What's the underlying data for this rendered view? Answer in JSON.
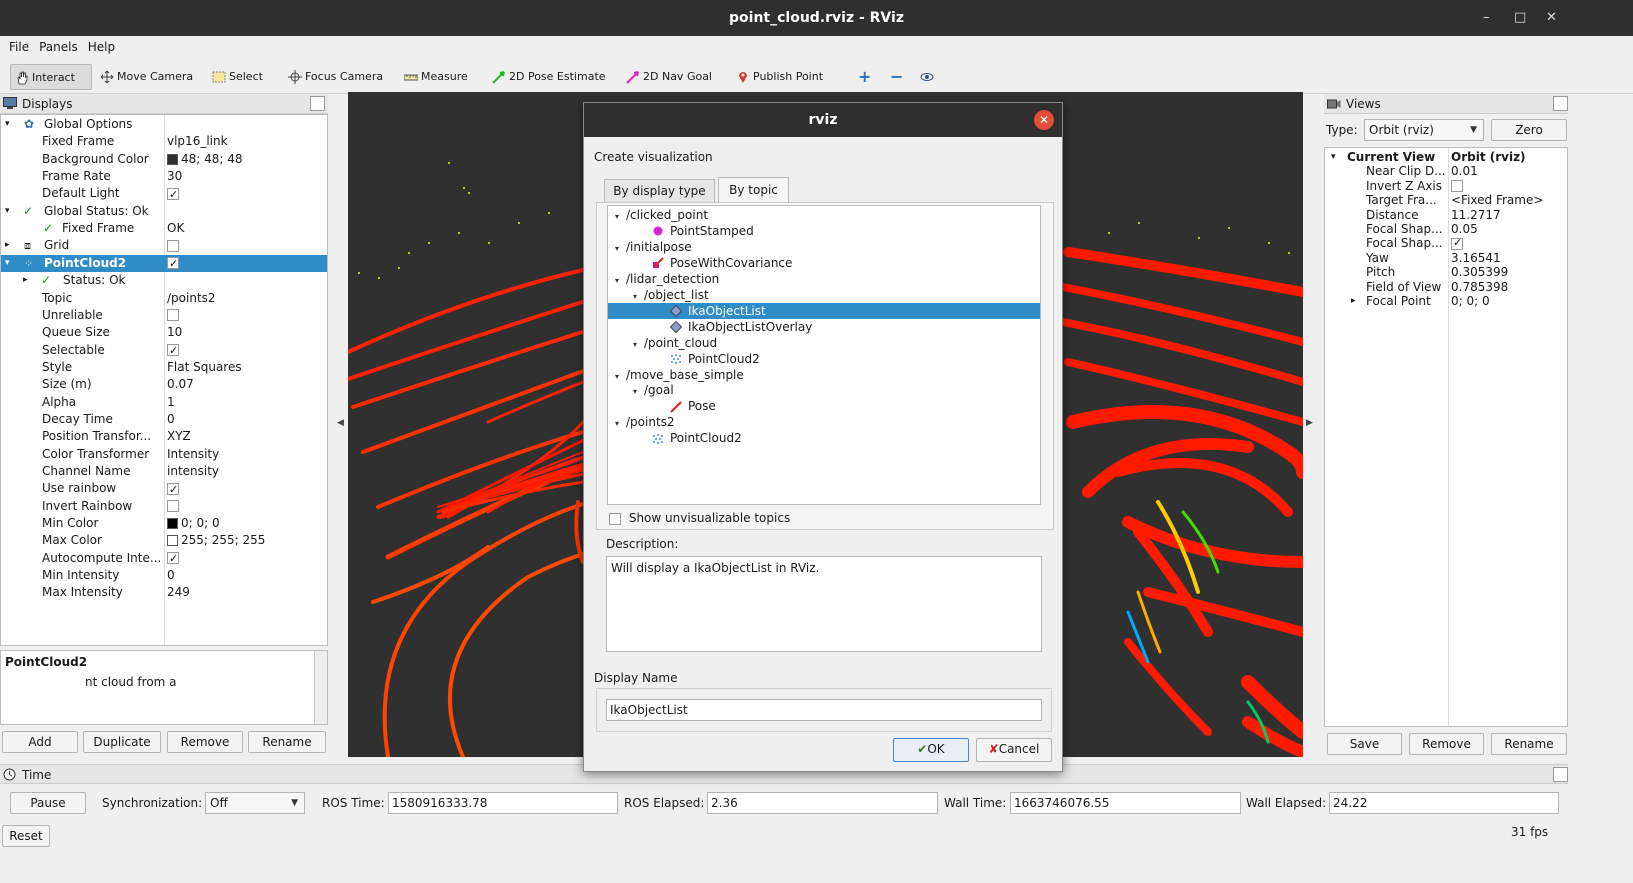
{
  "window": {
    "title": "point_cloud.rviz - RViz",
    "min": "–",
    "max": "□",
    "close": "✕"
  },
  "menu": [
    "File",
    "Panels",
    "Help"
  ],
  "toolbar": {
    "interact": "Interact",
    "move_camera": "Move Camera",
    "select": "Select",
    "focus_camera": "Focus Camera",
    "measure": "Measure",
    "pose_estimate": "2D Pose Estimate",
    "nav_goal": "2D Nav Goal",
    "publish_point": "Publish Point"
  },
  "displays": {
    "title": "Displays",
    "rows": [
      {
        "label": "Global Options",
        "value": ""
      },
      {
        "label": "Fixed Frame",
        "value": "vlp16_link"
      },
      {
        "label": "Background Color",
        "value": "48; 48; 48"
      },
      {
        "label": "Frame Rate",
        "value": "30"
      },
      {
        "label": "Default Light",
        "value": ""
      },
      {
        "label": "Global Status: Ok",
        "value": ""
      },
      {
        "label": "Fixed Frame",
        "value": "OK"
      },
      {
        "label": "Grid",
        "value": ""
      },
      {
        "label": "PointCloud2",
        "value": ""
      },
      {
        "label": "Status: Ok",
        "value": ""
      },
      {
        "label": "Topic",
        "value": "/points2"
      },
      {
        "label": "Unreliable",
        "value": ""
      },
      {
        "label": "Queue Size",
        "value": "10"
      },
      {
        "label": "Selectable",
        "value": ""
      },
      {
        "label": "Style",
        "value": "Flat Squares"
      },
      {
        "label": "Size (m)",
        "value": "0.07"
      },
      {
        "label": "Alpha",
        "value": "1"
      },
      {
        "label": "Decay Time",
        "value": "0"
      },
      {
        "label": "Position Transfor...",
        "value": "XYZ"
      },
      {
        "label": "Color Transformer",
        "value": "Intensity"
      },
      {
        "label": "Channel Name",
        "value": "intensity"
      },
      {
        "label": "Use rainbow",
        "value": ""
      },
      {
        "label": "Invert Rainbow",
        "value": ""
      },
      {
        "label": "Min Color",
        "value": "0; 0; 0"
      },
      {
        "label": "Max Color",
        "value": "255; 255; 255"
      },
      {
        "label": "Autocompute Inte...",
        "value": ""
      },
      {
        "label": "Min Intensity",
        "value": "0"
      },
      {
        "label": "Max Intensity",
        "value": "249"
      }
    ],
    "desc_title": "PointCloud2",
    "desc_text": "nt cloud from a",
    "buttons": {
      "add": "Add",
      "duplicate": "Duplicate",
      "remove": "Remove",
      "rename": "Rename"
    }
  },
  "dialog": {
    "title": "rviz",
    "heading": "Create visualization",
    "tab_type": "By display type",
    "tab_topic": "By topic",
    "tree": [
      {
        "label": "/clicked_point"
      },
      {
        "label": "PointStamped"
      },
      {
        "label": "/initialpose"
      },
      {
        "label": "PoseWithCovariance"
      },
      {
        "label": "/lidar_detection"
      },
      {
        "label": "/object_list"
      },
      {
        "label": "IkaObjectList"
      },
      {
        "label": "IkaObjectListOverlay"
      },
      {
        "label": "/point_cloud"
      },
      {
        "label": "PointCloud2"
      },
      {
        "label": "/move_base_simple"
      },
      {
        "label": "/goal"
      },
      {
        "label": "Pose"
      },
      {
        "label": "/points2"
      },
      {
        "label": "PointCloud2"
      }
    ],
    "show_unvisualizable": "Show unvisualizable topics",
    "description_label": "Description:",
    "description": "Will display a IkaObjectList in RViz.",
    "display_name_label": "Display Name",
    "display_name_value": "IkaObjectList",
    "ok": "OK",
    "cancel": "Cancel"
  },
  "views": {
    "title": "Views",
    "type_label": "Type:",
    "type_value": "Orbit (rviz)",
    "zero": "Zero",
    "rows": [
      {
        "label": "Current View",
        "value": "Orbit (rviz)"
      },
      {
        "label": "Near Clip D...",
        "value": "0.01"
      },
      {
        "label": "Invert Z Axis",
        "value": ""
      },
      {
        "label": "Target Fra...",
        "value": "<Fixed Frame>"
      },
      {
        "label": "Distance",
        "value": "11.2717"
      },
      {
        "label": "Focal Shap...",
        "value": "0.05"
      },
      {
        "label": "Focal Shap...",
        "value": ""
      },
      {
        "label": "Yaw",
        "value": "3.16541"
      },
      {
        "label": "Pitch",
        "value": "0.305399"
      },
      {
        "label": "Field of View",
        "value": "0.785398"
      },
      {
        "label": "Focal Point",
        "value": "0; 0; 0"
      }
    ],
    "buttons": {
      "save": "Save",
      "remove": "Remove",
      "rename": "Rename"
    }
  },
  "time": {
    "title": "Time",
    "pause": "Pause",
    "sync_label": "Synchronization:",
    "sync_value": "Off",
    "ros_time_label": "ROS Time:",
    "ros_time": "1580916333.78",
    "ros_elapsed_label": "ROS Elapsed:",
    "ros_elapsed": "2.36",
    "wall_time_label": "Wall Time:",
    "wall_time": "1663746076.55",
    "wall_elapsed_label": "Wall Elapsed:",
    "wall_elapsed": "24.22",
    "reset": "Reset",
    "fps": "31 fps"
  },
  "colors": {
    "accent": "#308cc6",
    "viewport_bg": "#303030",
    "points": "#ff1a00"
  }
}
